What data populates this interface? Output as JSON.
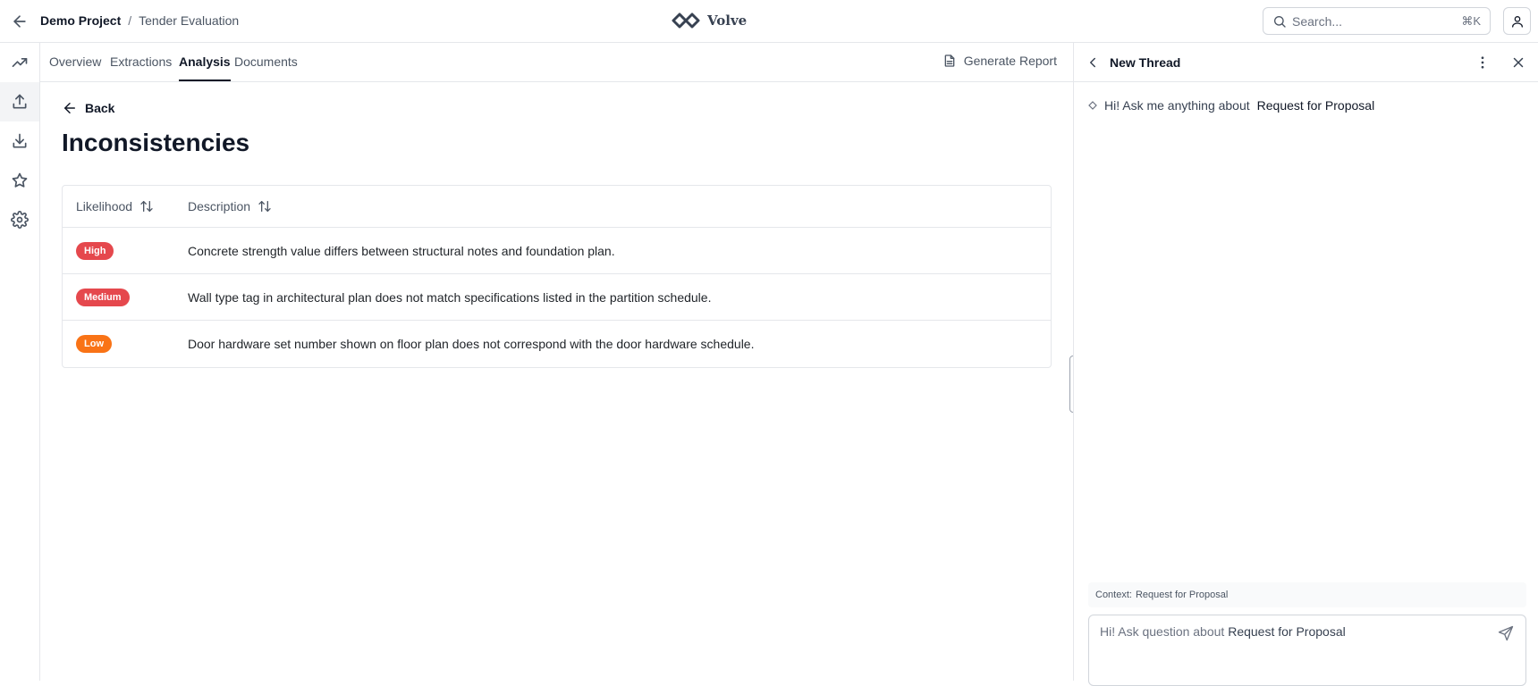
{
  "header": {
    "project": "Demo Project",
    "separator": "/",
    "page": "Tender Evaluation",
    "brand": "Volve",
    "search_placeholder": "Search...",
    "search_shortcut": "⌘K"
  },
  "tabs": [
    {
      "label": "Overview"
    },
    {
      "label": "Extractions"
    },
    {
      "label": "Analysis",
      "active": true
    },
    {
      "label": "Documents"
    }
  ],
  "generate_report": "Generate Report",
  "main": {
    "back_label": "Back",
    "title": "Inconsistencies",
    "columns": [
      "Likelihood",
      "Description"
    ],
    "rows": [
      {
        "likelihood": "High",
        "color": "#e5484d",
        "description": "Concrete strength value differs between structural notes and foundation plan."
      },
      {
        "likelihood": "Medium",
        "color": "#e5484d",
        "description": "Wall type tag in architectural plan does not match specifications listed in the partition schedule."
      },
      {
        "likelihood": "Low",
        "color": "#f97316",
        "description": "Door hardware set number shown on floor plan does not correspond with the door hardware schedule."
      }
    ]
  },
  "chat": {
    "title": "New Thread",
    "greeting_prefix": "Hi! Ask me anything about",
    "greeting_subject": "Request for Proposal",
    "context_label": "Context:",
    "context_value": "Request for Proposal",
    "composer_prefix": "Hi! Ask question about",
    "composer_subject": "Request for Proposal"
  },
  "icons": {
    "rail": [
      "trend-icon",
      "upload-icon",
      "download-icon",
      "star-icon",
      "settings-icon"
    ]
  }
}
